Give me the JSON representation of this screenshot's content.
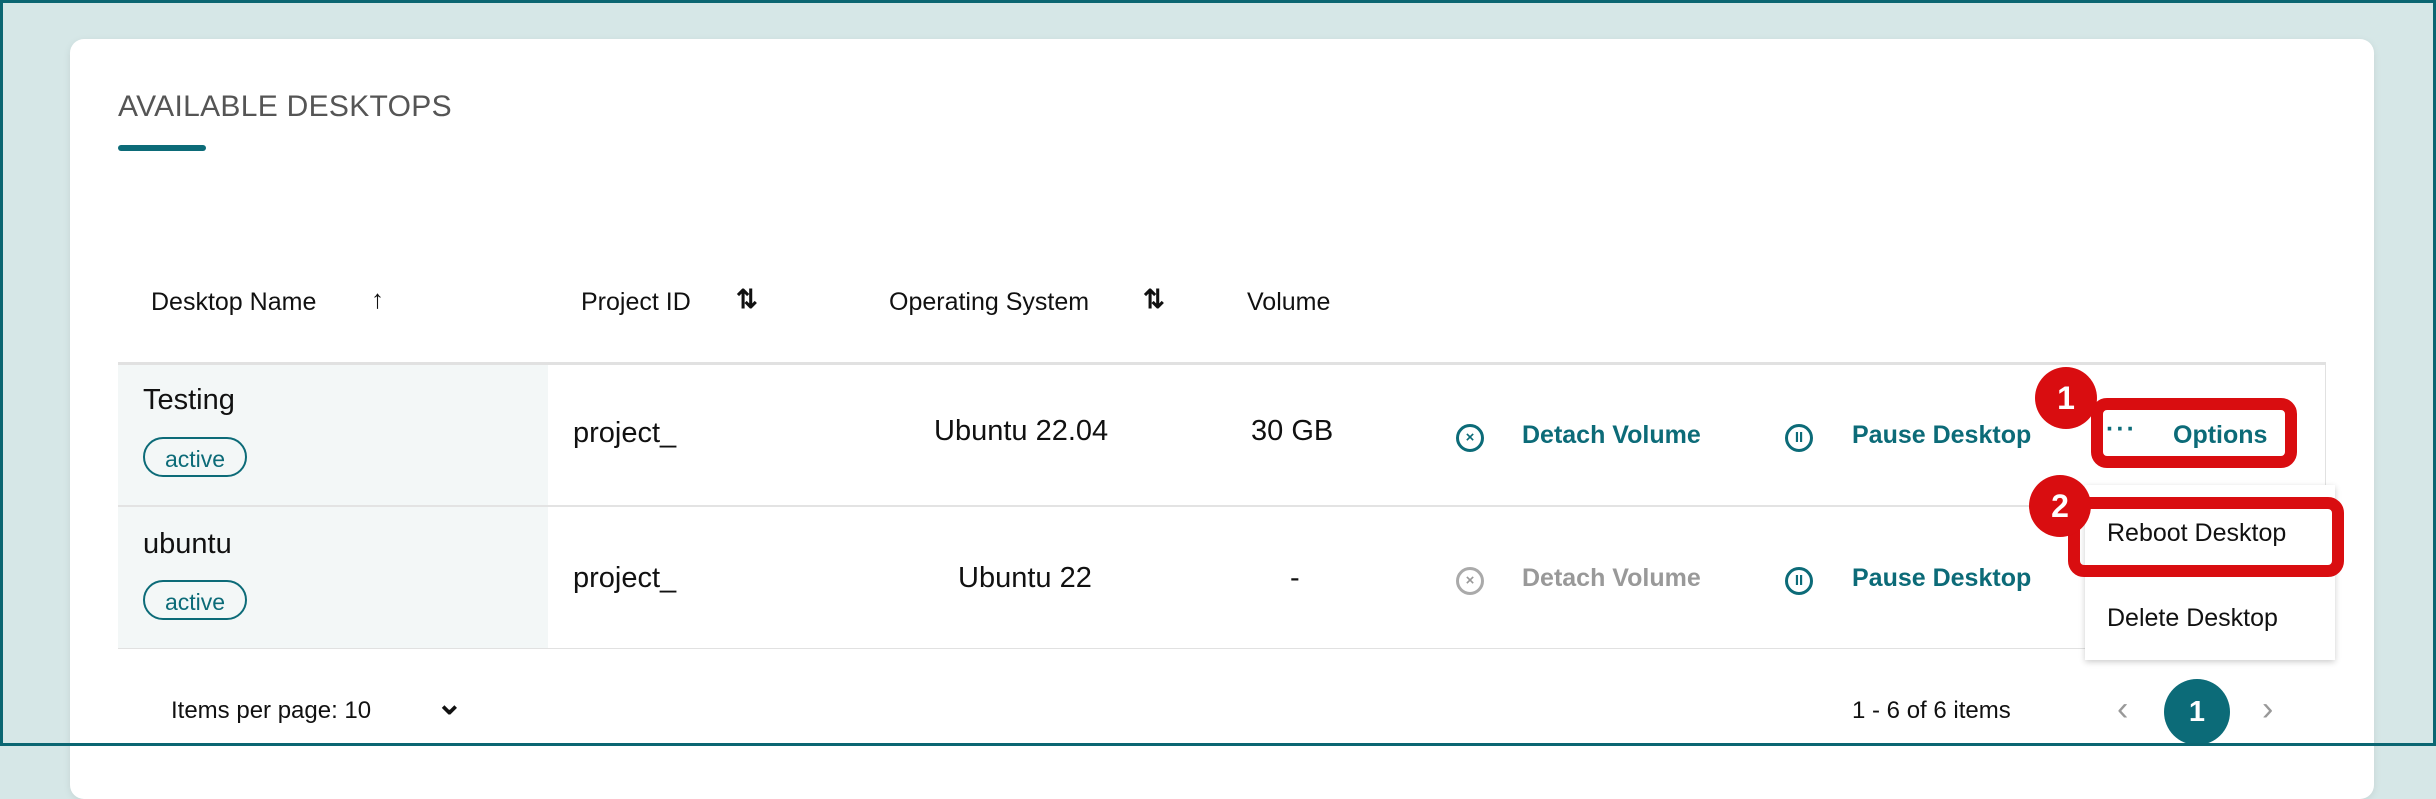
{
  "section_title": "AVAILABLE DESKTOPS",
  "columns": [
    {
      "label": "Desktop Name",
      "sort": "ascending"
    },
    {
      "label": "Project ID",
      "sort": "unsorted"
    },
    {
      "label": "Operating System",
      "sort": "unsorted"
    },
    {
      "label": "Volume"
    }
  ],
  "sort_glyphs": {
    "asc": "↑",
    "both": "⇅"
  },
  "rows": [
    {
      "name": "Testing",
      "status": "active",
      "project": "project_",
      "os": "Ubuntu 22.04",
      "volume": "30 GB",
      "detach_label": "Detach Volume",
      "detach_enabled": true,
      "pause_label": "Pause Desktop",
      "options_label": "Options"
    },
    {
      "name": "ubuntu",
      "status": "active",
      "project": "project_",
      "os": "Ubuntu 22",
      "volume": "-",
      "detach_label": "Detach Volume",
      "detach_enabled": false,
      "pause_label": "Pause Desktop"
    }
  ],
  "options_menu": {
    "items": [
      "Reboot Desktop",
      "Delete Desktop"
    ]
  },
  "annotations": [
    "1",
    "2"
  ],
  "footer": {
    "items_per_page": "Items per page: 10",
    "range": "1 - 6 of 6 items",
    "current_page": "1",
    "prev": "‹",
    "next": "›",
    "chevron": "⌄"
  },
  "icons": {
    "detach": "x-circle-icon",
    "pause": "pause-circle-icon",
    "more": "ellipsis-icon"
  },
  "colors": {
    "accent": "#0c6b78",
    "highlight": "#d90d10",
    "background": "#d6e7e7"
  }
}
